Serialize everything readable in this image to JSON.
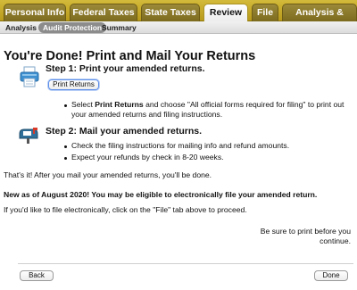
{
  "top_tabs": [
    {
      "label": "Personal Info",
      "active": false
    },
    {
      "label": "Federal Taxes",
      "active": false
    },
    {
      "label": "State Taxes",
      "active": false
    },
    {
      "label": "Review",
      "active": true
    },
    {
      "label": "File",
      "active": false
    },
    {
      "label": "Analysis & Advice",
      "active": false
    }
  ],
  "sub_tabs": [
    {
      "label": "Analysis",
      "active": false
    },
    {
      "label": "Audit Protection",
      "active": true
    },
    {
      "label": "Summary",
      "active": false
    }
  ],
  "title": "You're Done! Print and Mail Your Returns",
  "step1": {
    "heading": "Step 1: Print your amended returns.",
    "button": "Print Returns",
    "bullet_pre": "Select ",
    "bullet_bold": "Print Returns",
    "bullet_post_line1": " and choose \"All official forms required for filing\" to print out",
    "bullet_line2": "your amended returns and filing instructions."
  },
  "step2": {
    "heading": "Step 2: Mail your amended returns.",
    "bullets": [
      "Check the filing instructions for mailing info and refund amounts.",
      "Expect your refunds by check in 8-20 weeks."
    ]
  },
  "done_text": "That's it! After you mail your amended returns, you'll be done.",
  "new_text": "New as of August 2020! You may be eligible to electronically file your amended return.",
  "efile_text": "If you'd like to file electronically, click on the \"File\" tab above to proceed.",
  "reminder_line1": "Be sure to print before you",
  "reminder_line2": "continue.",
  "nav": {
    "back": "Back",
    "done": "Done"
  },
  "icons": {
    "step1": "printer-icon",
    "step2": "mailbox-icon"
  }
}
